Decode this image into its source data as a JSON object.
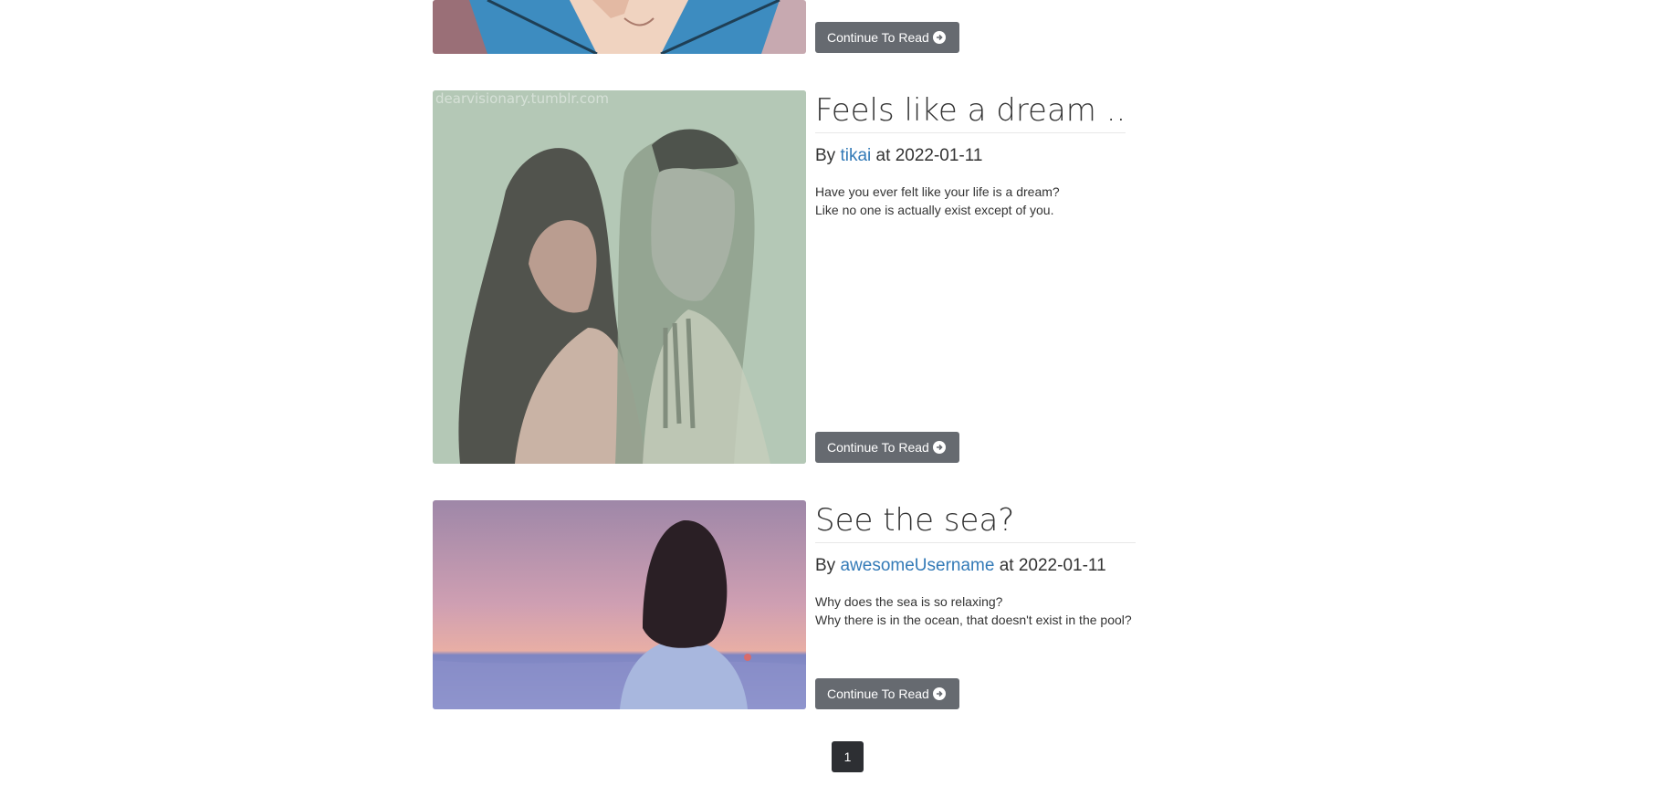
{
  "posts": [
    {
      "button_label": "Continue To Read",
      "image_alt": "anime character in blue jacket"
    },
    {
      "title": "Feels like a dream ..",
      "by_label": "By",
      "author": "tikai",
      "at_label": "at",
      "date": "2022-01-11",
      "excerpt_lines": [
        "Have you ever felt like your life is a dream?",
        "Like no one is actually exist except of you."
      ],
      "button_label": "Continue To Read",
      "image_watermark": "dearvisionary.tumblr.com"
    },
    {
      "title": "See the sea?",
      "by_label": "By",
      "author": "awesomeUsername",
      "at_label": "at",
      "date": "2022-01-11",
      "excerpt_lines": [
        "Why does the sea is so relaxing?",
        "Why there is in the ocean, that doesn't exist in the pool?"
      ],
      "button_label": "Continue To Read"
    }
  ],
  "pagination": {
    "current": "1"
  },
  "icons": {
    "continue": "arrow-circle-right-icon"
  }
}
